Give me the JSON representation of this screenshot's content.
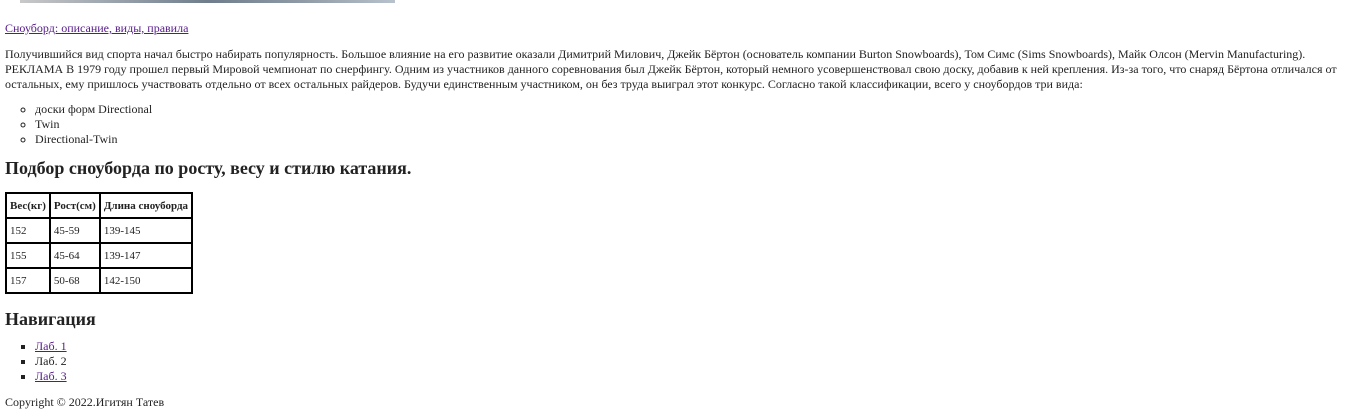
{
  "header": {
    "title_link": "Сноуборд: описание, виды, правила"
  },
  "article": {
    "paragraph": "Получившийся вид спорта начал быстро набирать популярность. Большое влияние на его развитие оказали Димитрий Милович, Джейк Бёртон (основатель компании Burton Snowboards), Том Симс (Sims Snowboards), Майк Олсон (Mervin Manufacturing). РЕКЛАМА В 1979 году прошел первый Мировой чемпионат по снерфингу. Одним из участников данного соревнования был Джейк Бёртон, который немного усовершенствовал свою доску, добавив к ней крепления. Из-за того, что снаряд Бёртона отличался от остальных, ему пришлось участвовать отдельно от всех остальных райдеров. Будучи единственным участником, он без труда выиграл этот конкурс. Согласно такой классификации, всего у сноубордов три вида:",
    "kinds": [
      "доски форм Directional",
      "Twin",
      "Directional-Twin"
    ]
  },
  "selection": {
    "heading": "Подбор сноуборда по росту, весу и стилю катания.",
    "table": {
      "headers": [
        "Вес(кг)",
        "Рост(см)",
        "Длина сноуборда"
      ],
      "rows": [
        [
          "152",
          "45-59",
          "139-145"
        ],
        [
          "155",
          "45-64",
          "139-147"
        ],
        [
          "157",
          "50-68",
          "142-150"
        ]
      ]
    }
  },
  "navigation": {
    "heading": "Навигация",
    "items": [
      {
        "label": "Лаб. 1",
        "link": true
      },
      {
        "label": "Лаб. 2",
        "link": false
      },
      {
        "label": "Лаб. 3",
        "link": true
      }
    ]
  },
  "footer": {
    "copyright": "Copyright © 2022.Игитян Татев"
  },
  "colors": {
    "link": "#551a8b",
    "text": "#222222",
    "border": "#000000"
  }
}
